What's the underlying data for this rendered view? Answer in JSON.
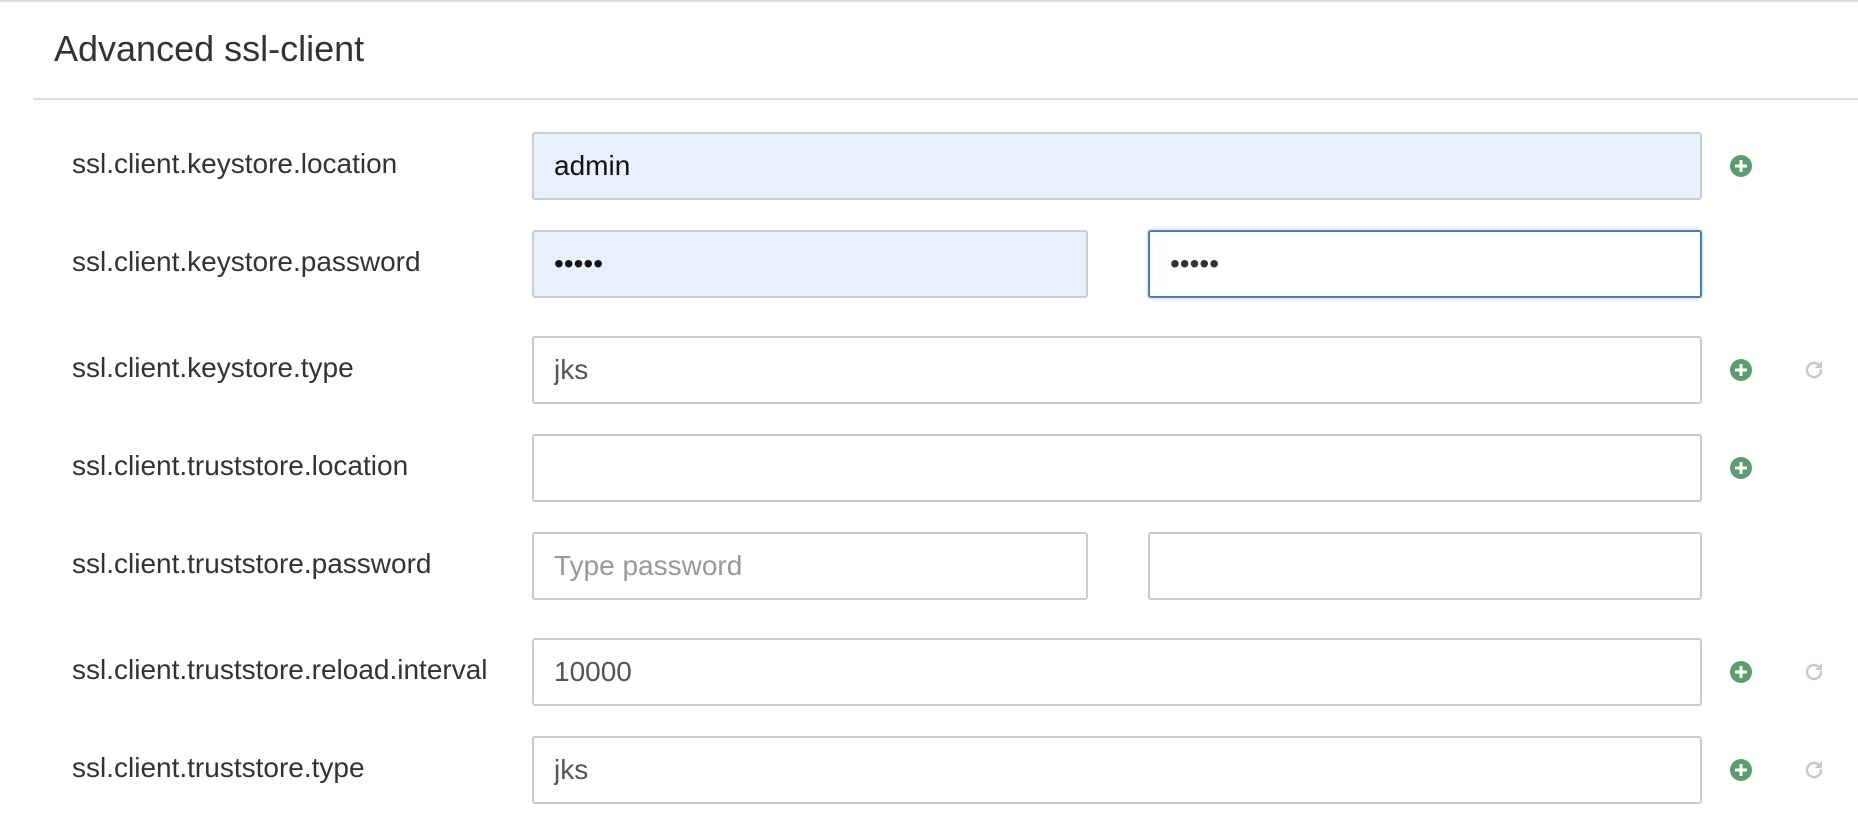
{
  "panel": {
    "title": "Advanced ssl-client"
  },
  "rows": [
    {
      "label": "ssl.client.keystore.location",
      "value": "admin",
      "placeholder": "",
      "add_icon": "plus-circle-icon"
    },
    {
      "label": "ssl.client.keystore.password",
      "value": "admin",
      "confirm_value": "admin",
      "placeholder": ""
    },
    {
      "label": "ssl.client.keystore.type",
      "value": "jks",
      "placeholder": "",
      "add_icon": "plus-circle-icon",
      "reset_icon": "refresh-icon"
    },
    {
      "label": "ssl.client.truststore.location",
      "value": "",
      "placeholder": "",
      "add_icon": "plus-circle-icon"
    },
    {
      "label": "ssl.client.truststore.password",
      "value": "",
      "placeholder": "Type password",
      "confirm_value": "",
      "confirm_placeholder": ""
    },
    {
      "label": "ssl.client.truststore.reload.interval",
      "value": "10000",
      "placeholder": "",
      "add_icon": "plus-circle-icon",
      "reset_icon": "refresh-icon"
    },
    {
      "label": "ssl.client.truststore.type",
      "value": "jks",
      "placeholder": "",
      "add_icon": "plus-circle-icon",
      "reset_icon": "refresh-icon"
    }
  ],
  "colors": {
    "add_icon": "#5a9e6f",
    "reset_icon": "#c8c8c8",
    "autofill_bg": "#e8f0fe",
    "focus_border": "#4a7fae"
  }
}
